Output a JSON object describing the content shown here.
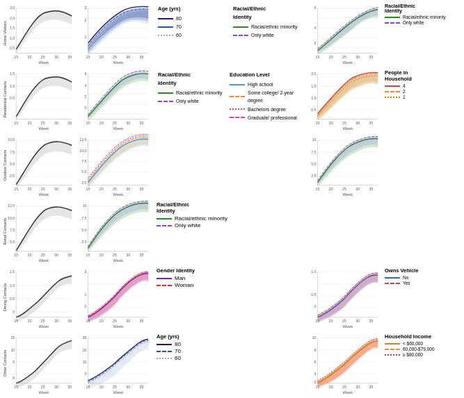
{
  "rows": [
    {
      "label": "Home Visitors"
    },
    {
      "label": "Residential Contacts"
    },
    {
      "label": "Outdoor Contacts"
    },
    {
      "label": "Retail Contacts"
    },
    {
      "label": "Dining Contacts"
    },
    {
      "label": "Other Contacts"
    }
  ],
  "legends": {
    "age": {
      "title": "Age (yrs)",
      "items": [
        {
          "label": "80",
          "color": "#1a1a6e",
          "dash": "solid"
        },
        {
          "label": "70",
          "color": "#1a5aaf",
          "dash": "dashed"
        },
        {
          "label": "60",
          "color": "#99aacc",
          "dash": "dotted"
        }
      ]
    },
    "racial1": {
      "title": "Racial/Ethnic Identity",
      "items": [
        {
          "label": "Racial/ethnic minority",
          "color": "#2a8a2a",
          "dash": "solid"
        },
        {
          "label": "Only white",
          "color": "#8844cc",
          "dash": "dashed"
        }
      ]
    },
    "racial2": {
      "title": "Racial/Ethnic Identity",
      "items": [
        {
          "label": "Racial/ethnic minority",
          "color": "#2a8a2a",
          "dash": "solid"
        },
        {
          "label": "Only white",
          "color": "#8844cc",
          "dash": "dashed"
        }
      ]
    },
    "education": {
      "title": "Education Level",
      "items": [
        {
          "label": "High school",
          "color": "#4499ee",
          "dash": "solid"
        },
        {
          "label": "Some college/ 2-year degree",
          "color": "#ee8833",
          "dash": "dashed"
        },
        {
          "label": "Bachelors degree",
          "color": "#cc4444",
          "dash": "dotted"
        },
        {
          "label": "Graduate/ professional",
          "color": "#cc44aa",
          "dash": "dotdash"
        }
      ]
    },
    "racial3": {
      "title": "Racial/Ethnic Identity",
      "items": [
        {
          "label": "Racial/ethnic minority",
          "color": "#2a8a2a",
          "dash": "solid"
        },
        {
          "label": "Only white",
          "color": "#8844cc",
          "dash": "dashed"
        }
      ]
    },
    "gender": {
      "title": "Gender Identity",
      "items": [
        {
          "label": "Man",
          "color": "#7722aa",
          "dash": "solid"
        },
        {
          "label": "Woman",
          "color": "#cc3333",
          "dash": "dashed"
        }
      ]
    },
    "owns_vehicle": {
      "title": "Owns Vehicle",
      "items": [
        {
          "label": "No",
          "color": "#3366cc",
          "dash": "solid"
        },
        {
          "label": "Yes",
          "color": "#cc4444",
          "dash": "dashed"
        }
      ]
    },
    "age2": {
      "title": "Age (yrs)",
      "items": [
        {
          "label": "80",
          "color": "#1a1a6e",
          "dash": "solid"
        },
        {
          "label": "70",
          "color": "#1a5aaf",
          "dash": "dashed"
        },
        {
          "label": "60",
          "color": "#99aacc",
          "dash": "dotted"
        }
      ]
    },
    "household_income": {
      "title": "Household Income",
      "items": [
        {
          "label": "< $60,000",
          "color": "#cc8800",
          "dash": "solid"
        },
        {
          "label": "60,000-$79,000",
          "color": "#ee8833",
          "dash": "dashed"
        },
        {
          "label": "≥ $80,000",
          "color": "#cc3333",
          "dash": "dotted"
        }
      ]
    },
    "people_household": {
      "title": "People in Household",
      "items": [
        {
          "label": "4",
          "color": "#cc4444",
          "dash": "solid"
        },
        {
          "label": "2",
          "color": "#ee8833",
          "dash": "dashed"
        },
        {
          "label": "1",
          "color": "#cc8800",
          "dash": "dotted"
        }
      ]
    }
  },
  "week_label": "Week"
}
